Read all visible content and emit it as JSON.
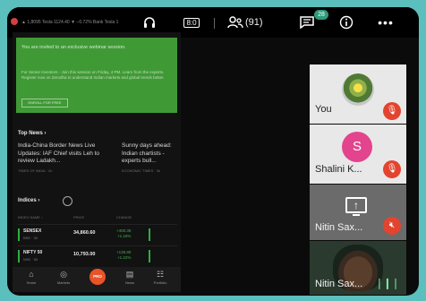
{
  "top_bar": {
    "ticker_text": "▲ 1,8095 Tesla 1124.40 ▼ −0.72%   Bank Tesla 1",
    "headphones_icon": "headphones-icon",
    "camera_label": "8:0",
    "participants_count": "(91)",
    "chat_badge": "28",
    "info_icon": "info-icon",
    "more_icon": "more-icon"
  },
  "shared_screen": {
    "banner": {
      "title": "You are invited to an exclusive webinar session.",
      "body": "For Senior Investors - Join this session on Friday, 4 PM. Learn from the experts. Register now on Zerodha to understand Indian markets and global trends better.",
      "button": "ENROLL FOR FREE"
    },
    "top_news": {
      "heading": "Top News ›",
      "item1": "India-China Border News Live Updates: IAF Chief visits Leh to review Ladakh...",
      "item1_source": "TIMES OF INDIA · 2h",
      "item2": "Sunny days ahead: Indian chartists - experts bull...",
      "item2_source": "ECONOMIC TIMES · 3h"
    },
    "indices": {
      "heading": "Indices ›",
      "subheader": [
        "INDEX NAME ↓",
        "PRICE",
        "CHANGE"
      ],
      "rows": [
        {
          "name": "SENSEX",
          "sub": "BSE · 30",
          "value": "34,860.60",
          "change": "+400.39",
          "pct": "+1.16%"
        },
        {
          "name": "NIFTY 50",
          "sub": "NSE · 50",
          "value": "10,793.00",
          "change": "+135.80",
          "pct": "+1.22%"
        }
      ]
    },
    "bottom_nav": [
      {
        "label": "Home",
        "icon": "home-icon"
      },
      {
        "label": "Markets",
        "icon": "markets-icon"
      },
      {
        "label": "PRO",
        "icon": "pro-icon"
      },
      {
        "label": "News",
        "icon": "news-icon"
      },
      {
        "label": "Portfolio",
        "icon": "portfolio-icon"
      }
    ]
  },
  "participants": [
    {
      "name": "You",
      "muted": true
    },
    {
      "name": "Shalini K...",
      "avatar_letter": "S",
      "muted": true
    },
    {
      "name": "Nitin Sax...",
      "sharing": true,
      "muted": true
    },
    {
      "name": "Nitin Sax...",
      "speaking": true
    }
  ],
  "colors": {
    "background": "#5bbfbd",
    "banner_green": "#3f9a36",
    "mute_red": "#e3442f",
    "avatar_pink": "#e3448e",
    "chat_badge_green": "#2e9c7c"
  }
}
